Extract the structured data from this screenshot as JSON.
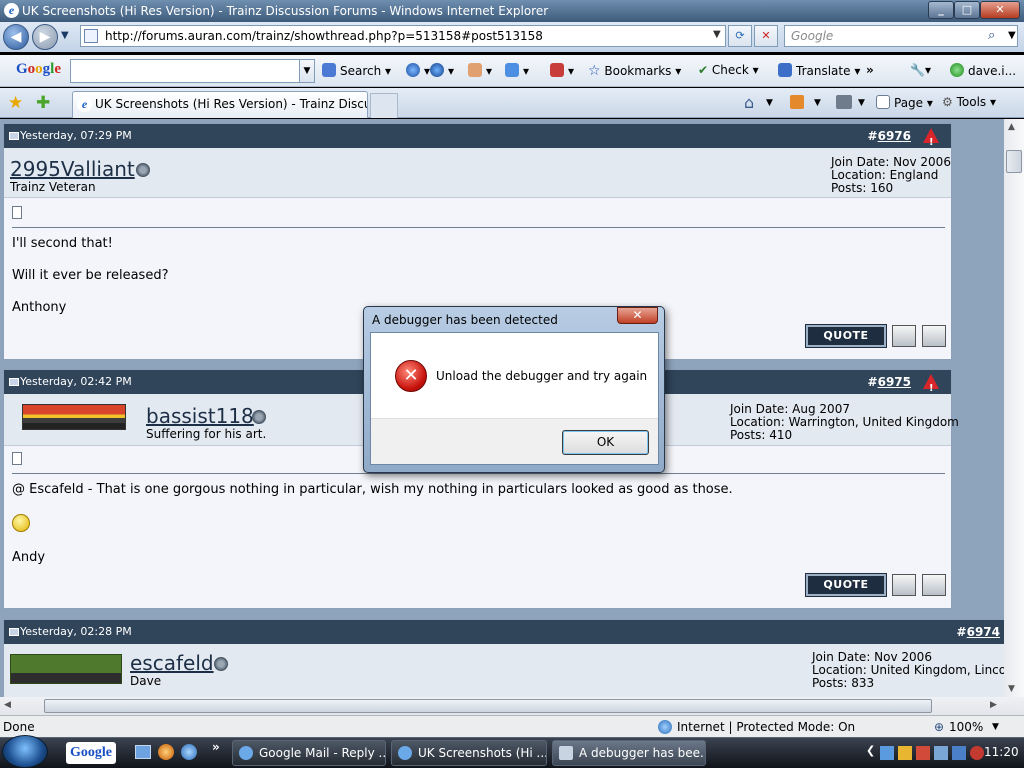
{
  "window": {
    "title": "UK Screenshots (Hi Res Version) - Trainz Discussion Forums - Windows Internet Explorer",
    "min": "_",
    "max": "□",
    "close": "✕"
  },
  "nav": {
    "back": "◀",
    "forward": "▶",
    "address": "http://forums.auran.com/trainz/showthread.php?p=513158#post513158",
    "search_placeholder": "Google"
  },
  "google_toolbar": {
    "logo": "Google",
    "search_label": "Search",
    "bookmarks_label": "Bookmarks",
    "check_label": "Check",
    "translate_label": "Translate",
    "more": "»",
    "user_label": "dave.i..."
  },
  "tabbar": {
    "tab_title": "UK Screenshots (Hi Res Version) - Trainz Discussi...",
    "page_label": "Page",
    "tools_label": "Tools"
  },
  "posts": [
    {
      "date": "Yesterday, 07:29 PM",
      "number_prefix": "#",
      "number": "6976",
      "username": "2995Valliant",
      "user_title": "Trainz Veteran",
      "join_date": "Join Date: Nov 2006",
      "location": "Location: England",
      "posts": "Posts: 160",
      "lines": [
        "I'll second that!",
        "Will it ever be released?",
        "Anthony"
      ],
      "quote_label": "QUOTE"
    },
    {
      "date": "Yesterday, 02:42 PM",
      "number_prefix": "#",
      "number": "6975",
      "username": "bassist118",
      "user_title": "Suffering for his art.",
      "join_date": "Join Date: Aug 2007",
      "location": "Location: Warrington, United Kingdom",
      "posts": "Posts: 410",
      "lines": [
        "@ Escafeld - That is one gorgous nothing in particular, wish my nothing in particulars looked as good as those.",
        "Andy"
      ],
      "quote_label": "QUOTE"
    },
    {
      "date": "Yesterday, 02:28 PM",
      "number_prefix": "#",
      "number": "6974",
      "username": "escafeld",
      "user_title": "Dave",
      "join_date": "Join Date: Nov 2006",
      "location": "Location: United Kingdom, Lincoln",
      "posts": "Posts: 833"
    }
  ],
  "dialog": {
    "title": "A debugger has been detected",
    "message": "Unload the debugger and try again",
    "ok_label": "OK",
    "close": "✕"
  },
  "status": {
    "left": "Done",
    "zone": "Internet | Protected Mode: On",
    "zoom": "100%"
  },
  "taskbar": {
    "google_label": "Google",
    "tasks": [
      "Google Mail - Reply ...",
      "UK Screenshots (Hi ...",
      "A debugger has bee..."
    ],
    "more": "»",
    "clock": "11:20"
  }
}
